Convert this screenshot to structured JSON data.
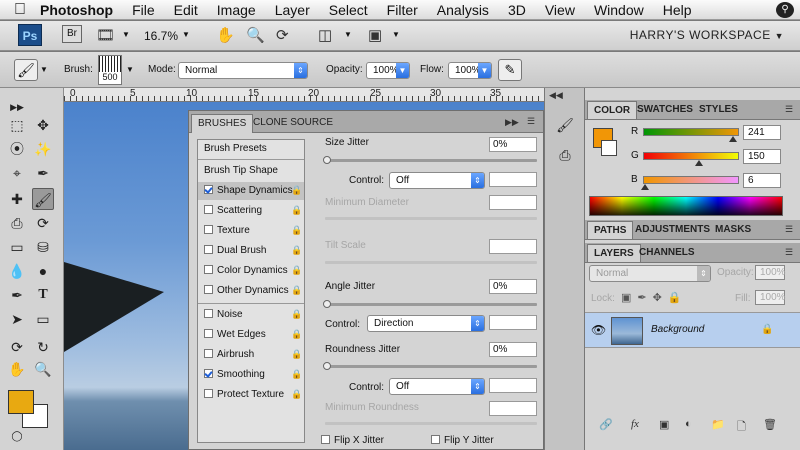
{
  "menubar": {
    "app_name": "Photoshop",
    "items": [
      "File",
      "Edit",
      "Image",
      "Layer",
      "Select",
      "Filter",
      "Analysis",
      "3D",
      "View",
      "Window",
      "Help"
    ]
  },
  "appbar": {
    "ps_logo": "Ps",
    "br_logo": "Br",
    "zoom": "16.7%",
    "workspace": "HARRY'S WORKSPACE"
  },
  "options": {
    "brush_label": "Brush:",
    "brush_size": "500",
    "mode_label": "Mode:",
    "mode_value": "Normal",
    "opacity_label": "Opacity:",
    "opacity_value": "100%",
    "flow_label": "Flow:",
    "flow_value": "100%"
  },
  "ruler": [
    "0",
    "5",
    "10",
    "15",
    "20",
    "25",
    "30",
    "35"
  ],
  "brushes_panel": {
    "tabs": [
      "BRUSHES",
      "CLONE SOURCE"
    ],
    "brush_presets": "Brush Presets",
    "brush_tip_shape": "Brush Tip Shape",
    "options": [
      {
        "label": "Shape Dynamics",
        "checked": true
      },
      {
        "label": "Scattering",
        "checked": false
      },
      {
        "label": "Texture",
        "checked": false
      },
      {
        "label": "Dual Brush",
        "checked": false
      },
      {
        "label": "Color Dynamics",
        "checked": false
      },
      {
        "label": "Other Dynamics",
        "checked": false
      },
      {
        "label": "Noise",
        "checked": false
      },
      {
        "label": "Wet Edges",
        "checked": false
      },
      {
        "label": "Airbrush",
        "checked": false
      },
      {
        "label": "Smoothing",
        "checked": true
      },
      {
        "label": "Protect Texture",
        "checked": false
      }
    ],
    "size_jitter_label": "Size Jitter",
    "size_jitter_value": "0%",
    "control_label": "Control:",
    "control1_value": "Off",
    "min_diameter_label": "Minimum Diameter",
    "tilt_scale_label": "Tilt Scale",
    "angle_jitter_label": "Angle Jitter",
    "angle_jitter_value": "0%",
    "control2_value": "Direction",
    "roundness_jitter_label": "Roundness Jitter",
    "roundness_jitter_value": "0%",
    "control3_value": "Off",
    "min_roundness_label": "Minimum Roundness",
    "flip_x_label": "Flip X Jitter",
    "flip_y_label": "Flip Y Jitter"
  },
  "color_panel": {
    "tabs": [
      "COLOR",
      "SWATCHES",
      "STYLES"
    ],
    "r_label": "R",
    "g_label": "G",
    "b_label": "B",
    "r_value": "241",
    "g_value": "150",
    "b_value": "6",
    "foreground_color": "#f19606"
  },
  "paths_bar": {
    "tabs": [
      "PATHS",
      "ADJUSTMENTS",
      "MASKS"
    ]
  },
  "layers_panel": {
    "tabs": [
      "LAYERS",
      "CHANNELS"
    ],
    "blend_mode": "Normal",
    "opacity_label": "Opacity:",
    "opacity_value": "100%",
    "lock_label": "Lock:",
    "fill_label": "Fill:",
    "fill_value": "100%",
    "layer_name": "Background"
  }
}
